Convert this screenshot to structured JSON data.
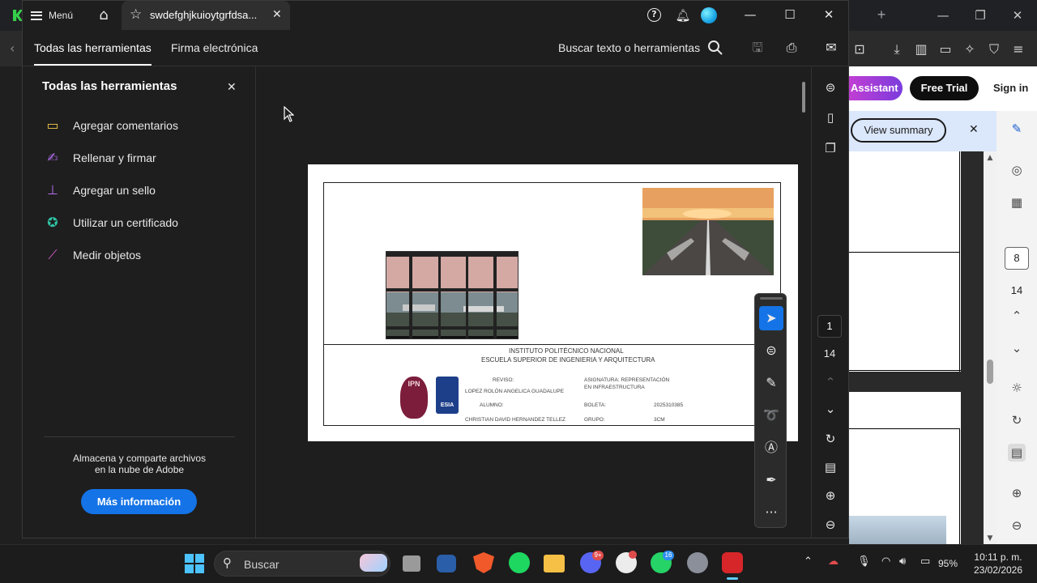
{
  "browser": {
    "assistant_label": "Assistant",
    "free_trial_label": "Free Trial",
    "sign_in_label": "Sign in",
    "view_summary_label": "View summary",
    "summary_close": "✕",
    "rail_page_current": "8",
    "rail_page_total": "14"
  },
  "titlebar": {
    "menu_label": "Menú",
    "tab_title": "swdefghjkuioytgrfdsa...",
    "tab_close": "✕",
    "help_glyph": "?",
    "minimize": "—",
    "maximize": "☐",
    "close": "✕"
  },
  "toolbar": {
    "tab_all_tools": "Todas las herramientas",
    "tab_esign": "Firma electrónica",
    "search_placeholder": "Buscar texto o herramientas"
  },
  "tools_panel": {
    "title": "Todas las herramientas",
    "close": "✕",
    "items": [
      {
        "label": "Agregar comentarios",
        "icon": "comment-icon",
        "color": "#f2c94c"
      },
      {
        "label": "Rellenar y firmar",
        "icon": "sign-pen-icon",
        "color": "#b46ef0"
      },
      {
        "label": "Agregar un sello",
        "icon": "stamp-icon",
        "color": "#b46ef0"
      },
      {
        "label": "Utilizar un certificado",
        "icon": "certificate-icon",
        "color": "#2ec4a6"
      },
      {
        "label": "Medir objetos",
        "icon": "ruler-icon",
        "color": "#e05bd0"
      }
    ],
    "cloud_text": "Almacena y comparte archivos\nen la nube de Adobe",
    "more_info_label": "Más información"
  },
  "pdf": {
    "institution": "INSTITUTO POLITÉCNICO NACIONAL",
    "school": "ESCUELA SUPERIOR DE INGENIERIA Y ARQUITECTURA",
    "reviso_label": "REVISO:",
    "reviso_name": "LOPEZ ROLÓN ANGELICA GUADALUPE",
    "alumno_label": "ALUMNO:",
    "alumno_name": "CHRISTIAN DAVID HERNANDEZ TELLEZ",
    "asignatura_line1": "ASIGNATURA: REPRESENTACIÓN",
    "asignatura_line2": "EN INFRAESTRUCTURA",
    "boleta_label": "BOLETA:",
    "boleta_value": "2025310385",
    "grupo_label": "GRUPO:",
    "grupo_value": "3CM",
    "logo_ipn_text": "IPN",
    "logo_esia_text": "ESIA"
  },
  "right_rail": {
    "page_current": "1",
    "page_total": "14"
  },
  "quick_tools": {
    "more": "···"
  },
  "taskbar": {
    "search_label": "Buscar",
    "discord_badge": "9+",
    "whatsapp_badge": "16",
    "battery": "95%",
    "time": "10:11 p. m.",
    "date": "23/02/2026"
  }
}
